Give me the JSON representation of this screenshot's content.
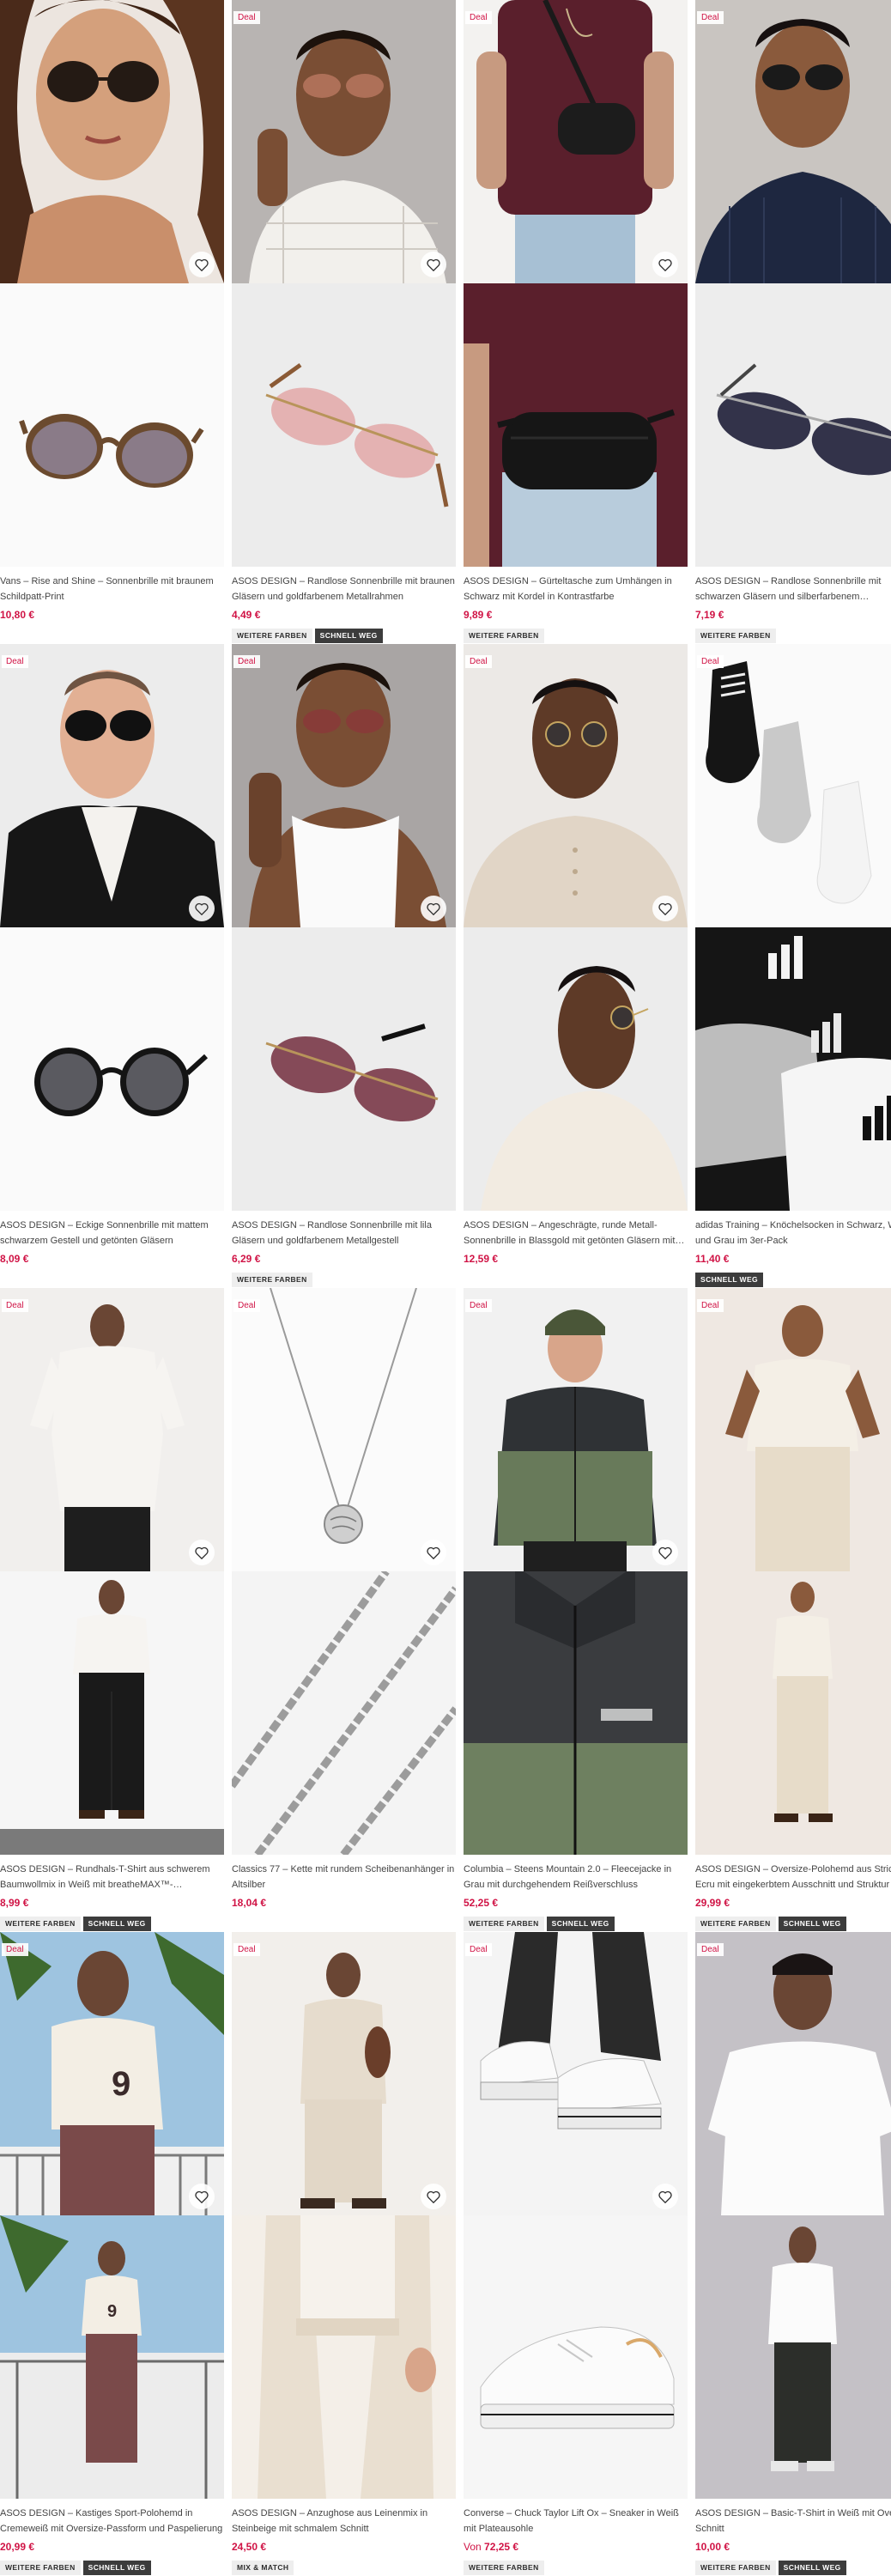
{
  "labels": {
    "deal": "Deal",
    "more_colors": "WEITERE FARBEN",
    "selling_fast": "SCHNELL WEG",
    "mix_match": "MIX & MATCH",
    "from": "Von"
  },
  "products": [
    {
      "title": "Vans – Rise and Shine – Sonnenbrille mit braunem Schildpatt-Print",
      "price": "10,80 €",
      "deal": false,
      "badges": []
    },
    {
      "title": "ASOS DESIGN – Randlose Sonnenbrille mit braunen Gläsern und goldfarbenem Metallrahmen",
      "price": "4,49 €",
      "deal": true,
      "badges": [
        "more",
        "fast"
      ]
    },
    {
      "title": "ASOS DESIGN – Gürteltasche zum Umhängen in Schwarz mit Kordel in Kontrastfarbe",
      "price": "9,89 €",
      "deal": true,
      "badges": [
        "more"
      ]
    },
    {
      "title": "ASOS DESIGN – Randlose Sonnenbrille mit schwarzen Gläsern und silberfarbenem…",
      "price": "7,19 €",
      "deal": true,
      "badges": [
        "more"
      ]
    },
    {
      "title": "ASOS DESIGN – Eckige Sonnenbrille mit mattem schwarzem Gestell und getönten Gläsern",
      "price": "8,09 €",
      "deal": true,
      "badges": []
    },
    {
      "title": "ASOS DESIGN – Randlose Sonnenbrille mit lila Gläsern und goldfarbenem Metallgestell",
      "price": "6,29 €",
      "deal": true,
      "badges": [
        "more"
      ]
    },
    {
      "title": "ASOS DESIGN – Angeschrägte, runde Metall-Sonnenbrille in Blassgold mit getönten Gläsern mit…",
      "price": "12,59 €",
      "deal": true,
      "badges": []
    },
    {
      "title": "adidas Training – Knöchelsocken in Schwarz, Weiß und Grau im 3er-Pack",
      "price": "11,40 €",
      "deal": true,
      "badges": [
        "fast"
      ]
    },
    {
      "title": "ASOS DESIGN – Rundhals-T-Shirt aus schwerem Baumwollmix in Weiß mit breatheMAX™-…",
      "price": "8,99 €",
      "deal": true,
      "badges": [
        "more",
        "fast"
      ]
    },
    {
      "title": "Classics 77 – Kette mit rundem Scheibenanhänger in Altsilber",
      "price": "18,04 €",
      "deal": true,
      "badges": []
    },
    {
      "title": "Columbia – Steens Mountain 2.0 – Fleecejacke in Grau mit durchgehendem Reißverschluss",
      "price": "52,25 €",
      "deal": true,
      "badges": [
        "more",
        "fast"
      ]
    },
    {
      "title": "ASOS DESIGN – Oversize-Polohemd aus Strick in Ecru mit eingekerbtem Ausschnitt und Struktur",
      "price": "29,99 €",
      "deal": true,
      "badges": [
        "more",
        "fast"
      ]
    },
    {
      "title": "ASOS DESIGN – Kastiges Sport-Polohemd in Cremeweiß mit Oversize-Passform und Paspelierung",
      "price": "20,99 €",
      "deal": true,
      "badges": [
        "more",
        "fast"
      ]
    },
    {
      "title": "ASOS DESIGN – Anzughose aus Leinenmix in Steinbeige mit schmalem Schnitt",
      "price": "24,50 €",
      "deal": true,
      "badges": [
        "mix"
      ]
    },
    {
      "title": "Converse – Chuck Taylor Lift Ox – Sneaker in Weiß mit Plateausohle",
      "price": "72,25 €",
      "from": true,
      "deal": true,
      "badges": [
        "more"
      ]
    },
    {
      "title": "ASOS DESIGN – Basic-T-Shirt in Weiß mit Oversize-Schnitt",
      "price": "10,00 €",
      "deal": true,
      "badges": [
        "more",
        "fast"
      ]
    }
  ]
}
